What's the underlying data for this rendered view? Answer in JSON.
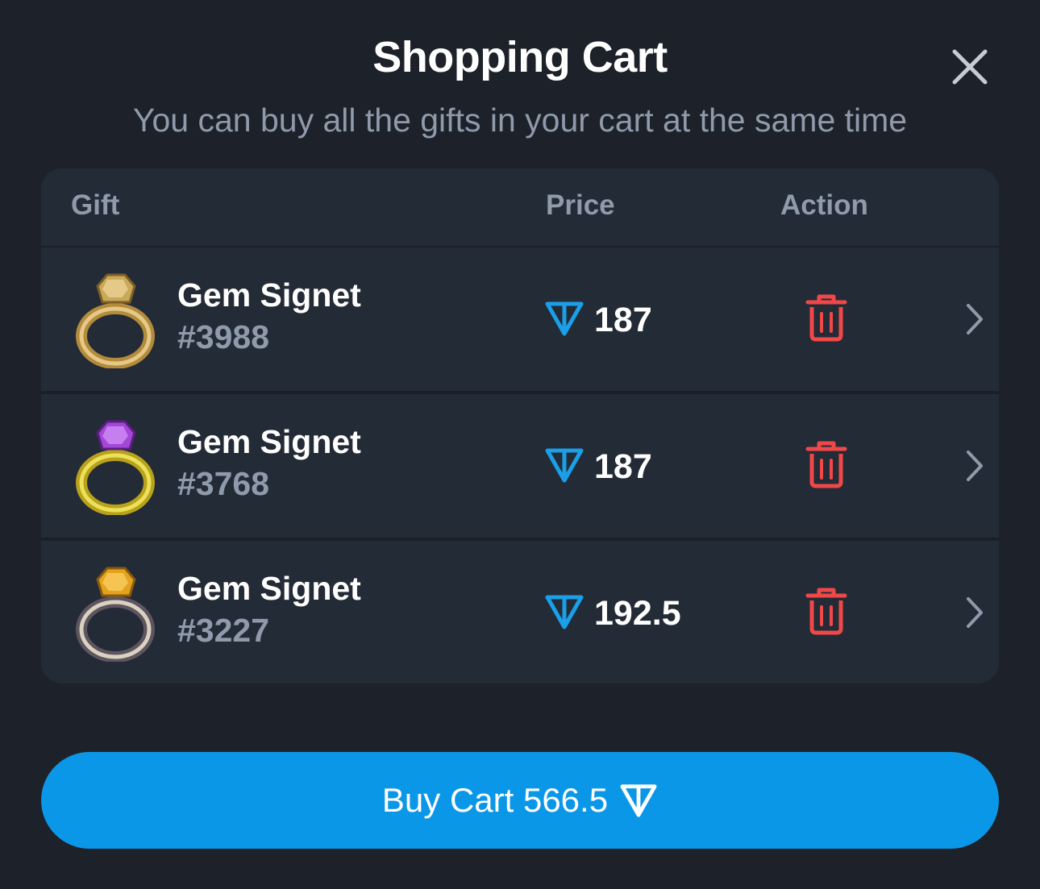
{
  "header": {
    "title": "Shopping Cart",
    "subtitle": "You can buy all the gifts in your cart at the same time"
  },
  "table": {
    "columns": [
      "Gift",
      "Price",
      "Action"
    ],
    "rows": [
      {
        "name": "Gem Signet",
        "number": "#3988",
        "price": "187",
        "gem_color": "#c9a85a"
      },
      {
        "name": "Gem Signet",
        "number": "#3768",
        "price": "187",
        "gem_color": "#a347d6"
      },
      {
        "name": "Gem Signet",
        "number": "#3227",
        "price": "192.5",
        "gem_color": "#e3a31f"
      }
    ]
  },
  "footer": {
    "buy_label": "Buy Cart 566.5"
  },
  "colors": {
    "accent": "#0b97e8",
    "delete": "#f04848",
    "ton": "#1a9fe8"
  },
  "icons": [
    "close-icon",
    "ton-icon",
    "trash-icon",
    "chevron-right-icon",
    "ring-image"
  ]
}
